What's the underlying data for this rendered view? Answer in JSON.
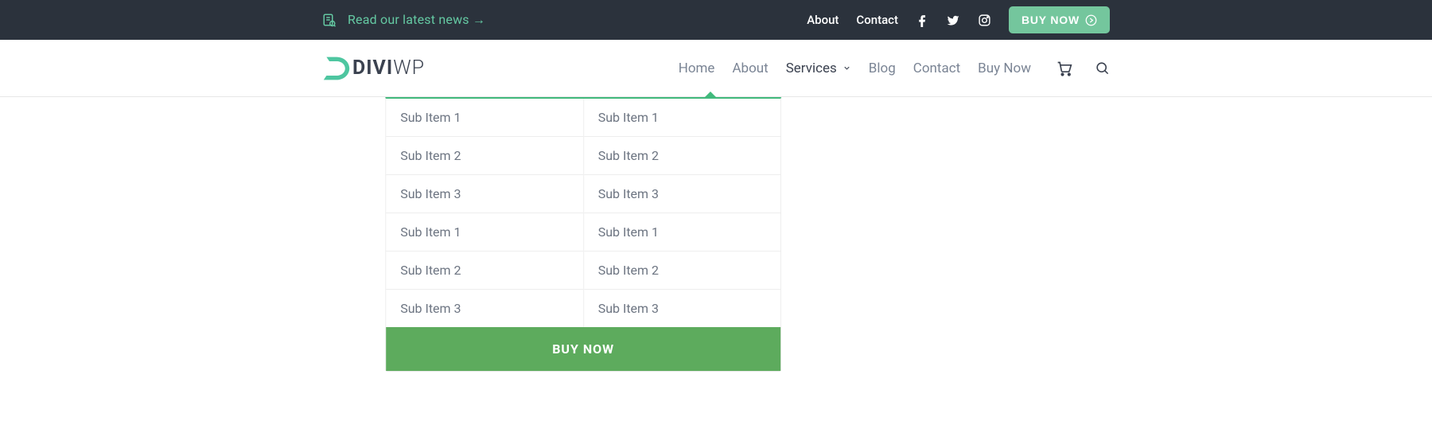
{
  "topbar": {
    "news_label": "Read our latest news →",
    "links": {
      "about": "About",
      "contact": "Contact"
    },
    "buynow_label": "BUY NOW"
  },
  "brand": {
    "part1": "DIVI",
    "part2": "WP"
  },
  "nav": {
    "home": "Home",
    "about": "About",
    "services": "Services",
    "blog": "Blog",
    "contact": "Contact",
    "buynow": "Buy Now"
  },
  "mega": {
    "col1": [
      "Sub Item 1",
      "Sub Item 2",
      "Sub Item 3",
      "Sub Item 1",
      "Sub Item 2",
      "Sub Item 3"
    ],
    "col2": [
      "Sub Item 1",
      "Sub Item 2",
      "Sub Item 3",
      "Sub Item 1",
      "Sub Item 2",
      "Sub Item 3"
    ],
    "cta": "BUY NOW"
  },
  "colors": {
    "accent_green_light": "#74c69d",
    "accent_green": "#41b97c",
    "cta_green": "#5dab5d",
    "dark": "#2b323c"
  }
}
